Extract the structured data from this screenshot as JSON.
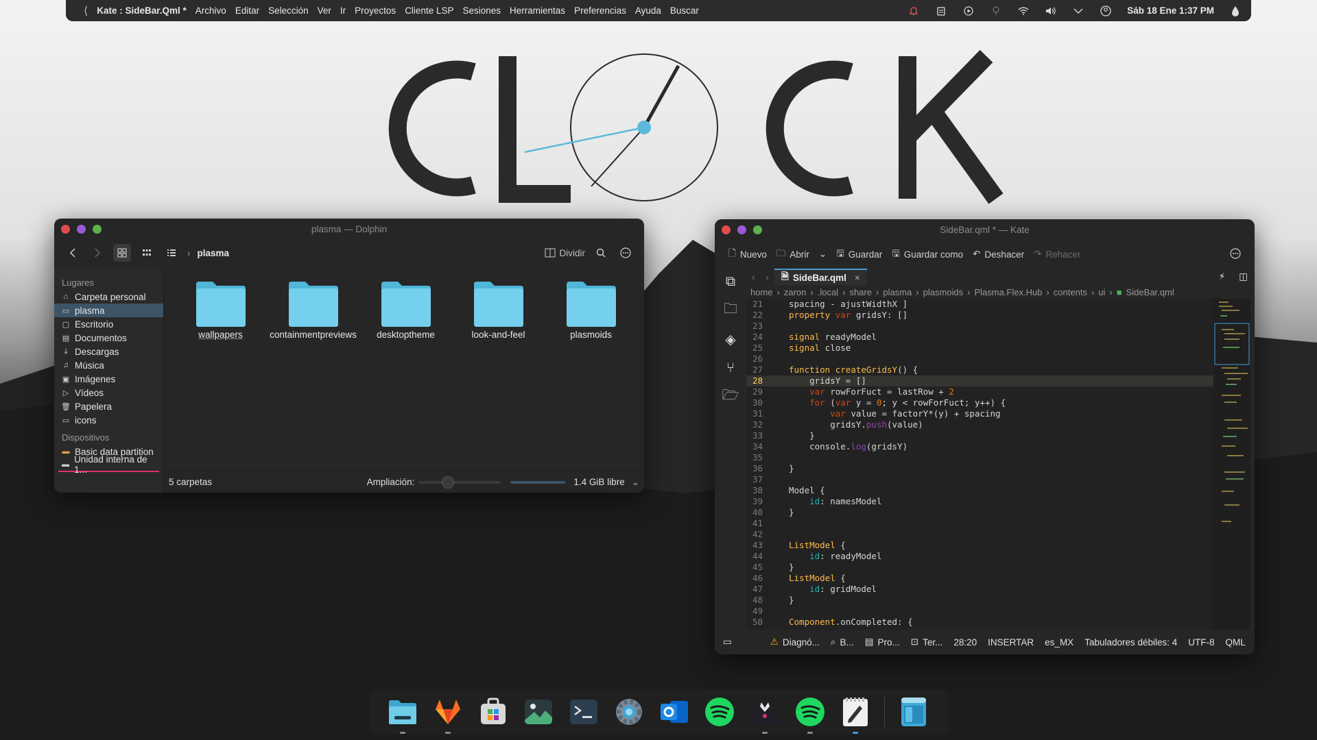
{
  "topbar": {
    "app_title": "Kate : SideBar.Qml *",
    "menu": [
      "Archivo",
      "Editar",
      "Selección",
      "Ver",
      "Ir",
      "Proyectos",
      "Cliente LSP",
      "Sesiones",
      "Herramientas",
      "Preferencias",
      "Ayuda",
      "Buscar"
    ],
    "datetime": "Sáb 18 Ene  1:37 PM"
  },
  "wallpaper": {
    "logo_text": "CLOCK"
  },
  "dolphin": {
    "title": "plasma — Dolphin",
    "breadcrumb": "plasma",
    "split_label": "Dividir",
    "places_header": "Lugares",
    "places": [
      "Carpeta personal",
      "plasma",
      "Escritorio",
      "Documentos",
      "Descargas",
      "Música",
      "Imágenes",
      "Vídeos",
      "Papelera",
      "icons"
    ],
    "devices_header": "Dispositivos",
    "devices": [
      "Basic data partition",
      "Unidad interna de 1..."
    ],
    "folders": [
      "wallpapers",
      "containmentpreviews",
      "desktoptheme",
      "look-and-feel",
      "plasmoids"
    ],
    "status_count": "5 carpetas",
    "zoom_label": "Ampliación:",
    "free_space": "1.4 GiB libre"
  },
  "kate": {
    "title": "SideBar.qml * — Kate",
    "toolbar": {
      "new": "Nuevo",
      "open": "Abrir",
      "save": "Guardar",
      "save_as": "Guardar como",
      "undo": "Deshacer",
      "redo": "Rehacer"
    },
    "tab": "SideBar.qml",
    "breadcrumb": [
      "home",
      "zaron",
      ".local",
      "share",
      "plasma",
      "plasmoids",
      "Plasma.Flex.Hub",
      "contents",
      "ui",
      "SideBar.qml"
    ],
    "current_line": 28,
    "status": {
      "diagnostics": "Diagnó...",
      "search": "B...",
      "projects": "Pro...",
      "terminal": "Ter...",
      "cursor": "28:20",
      "mode": "INSERTAR",
      "lang": "es_MX",
      "indent": "Tabuladores débiles: 4",
      "encoding": "UTF-8",
      "syntax": "QML"
    }
  },
  "dock": {
    "apps": [
      "dolphin-icon",
      "gitlab-icon",
      "store-icon",
      "image-viewer-icon",
      "terminal-icon",
      "settings-icon",
      "outlook-icon",
      "spotify-icon",
      "wallpaper-app-icon",
      "spotify-alt-icon",
      "kate-icon",
      "window-app-icon"
    ]
  },
  "colors": {
    "accent": "#4a9bd6",
    "folder": "#6fcde8",
    "close": "#e24b4b",
    "minimize": "#9a5ad6",
    "maximize": "#5fb04d"
  }
}
